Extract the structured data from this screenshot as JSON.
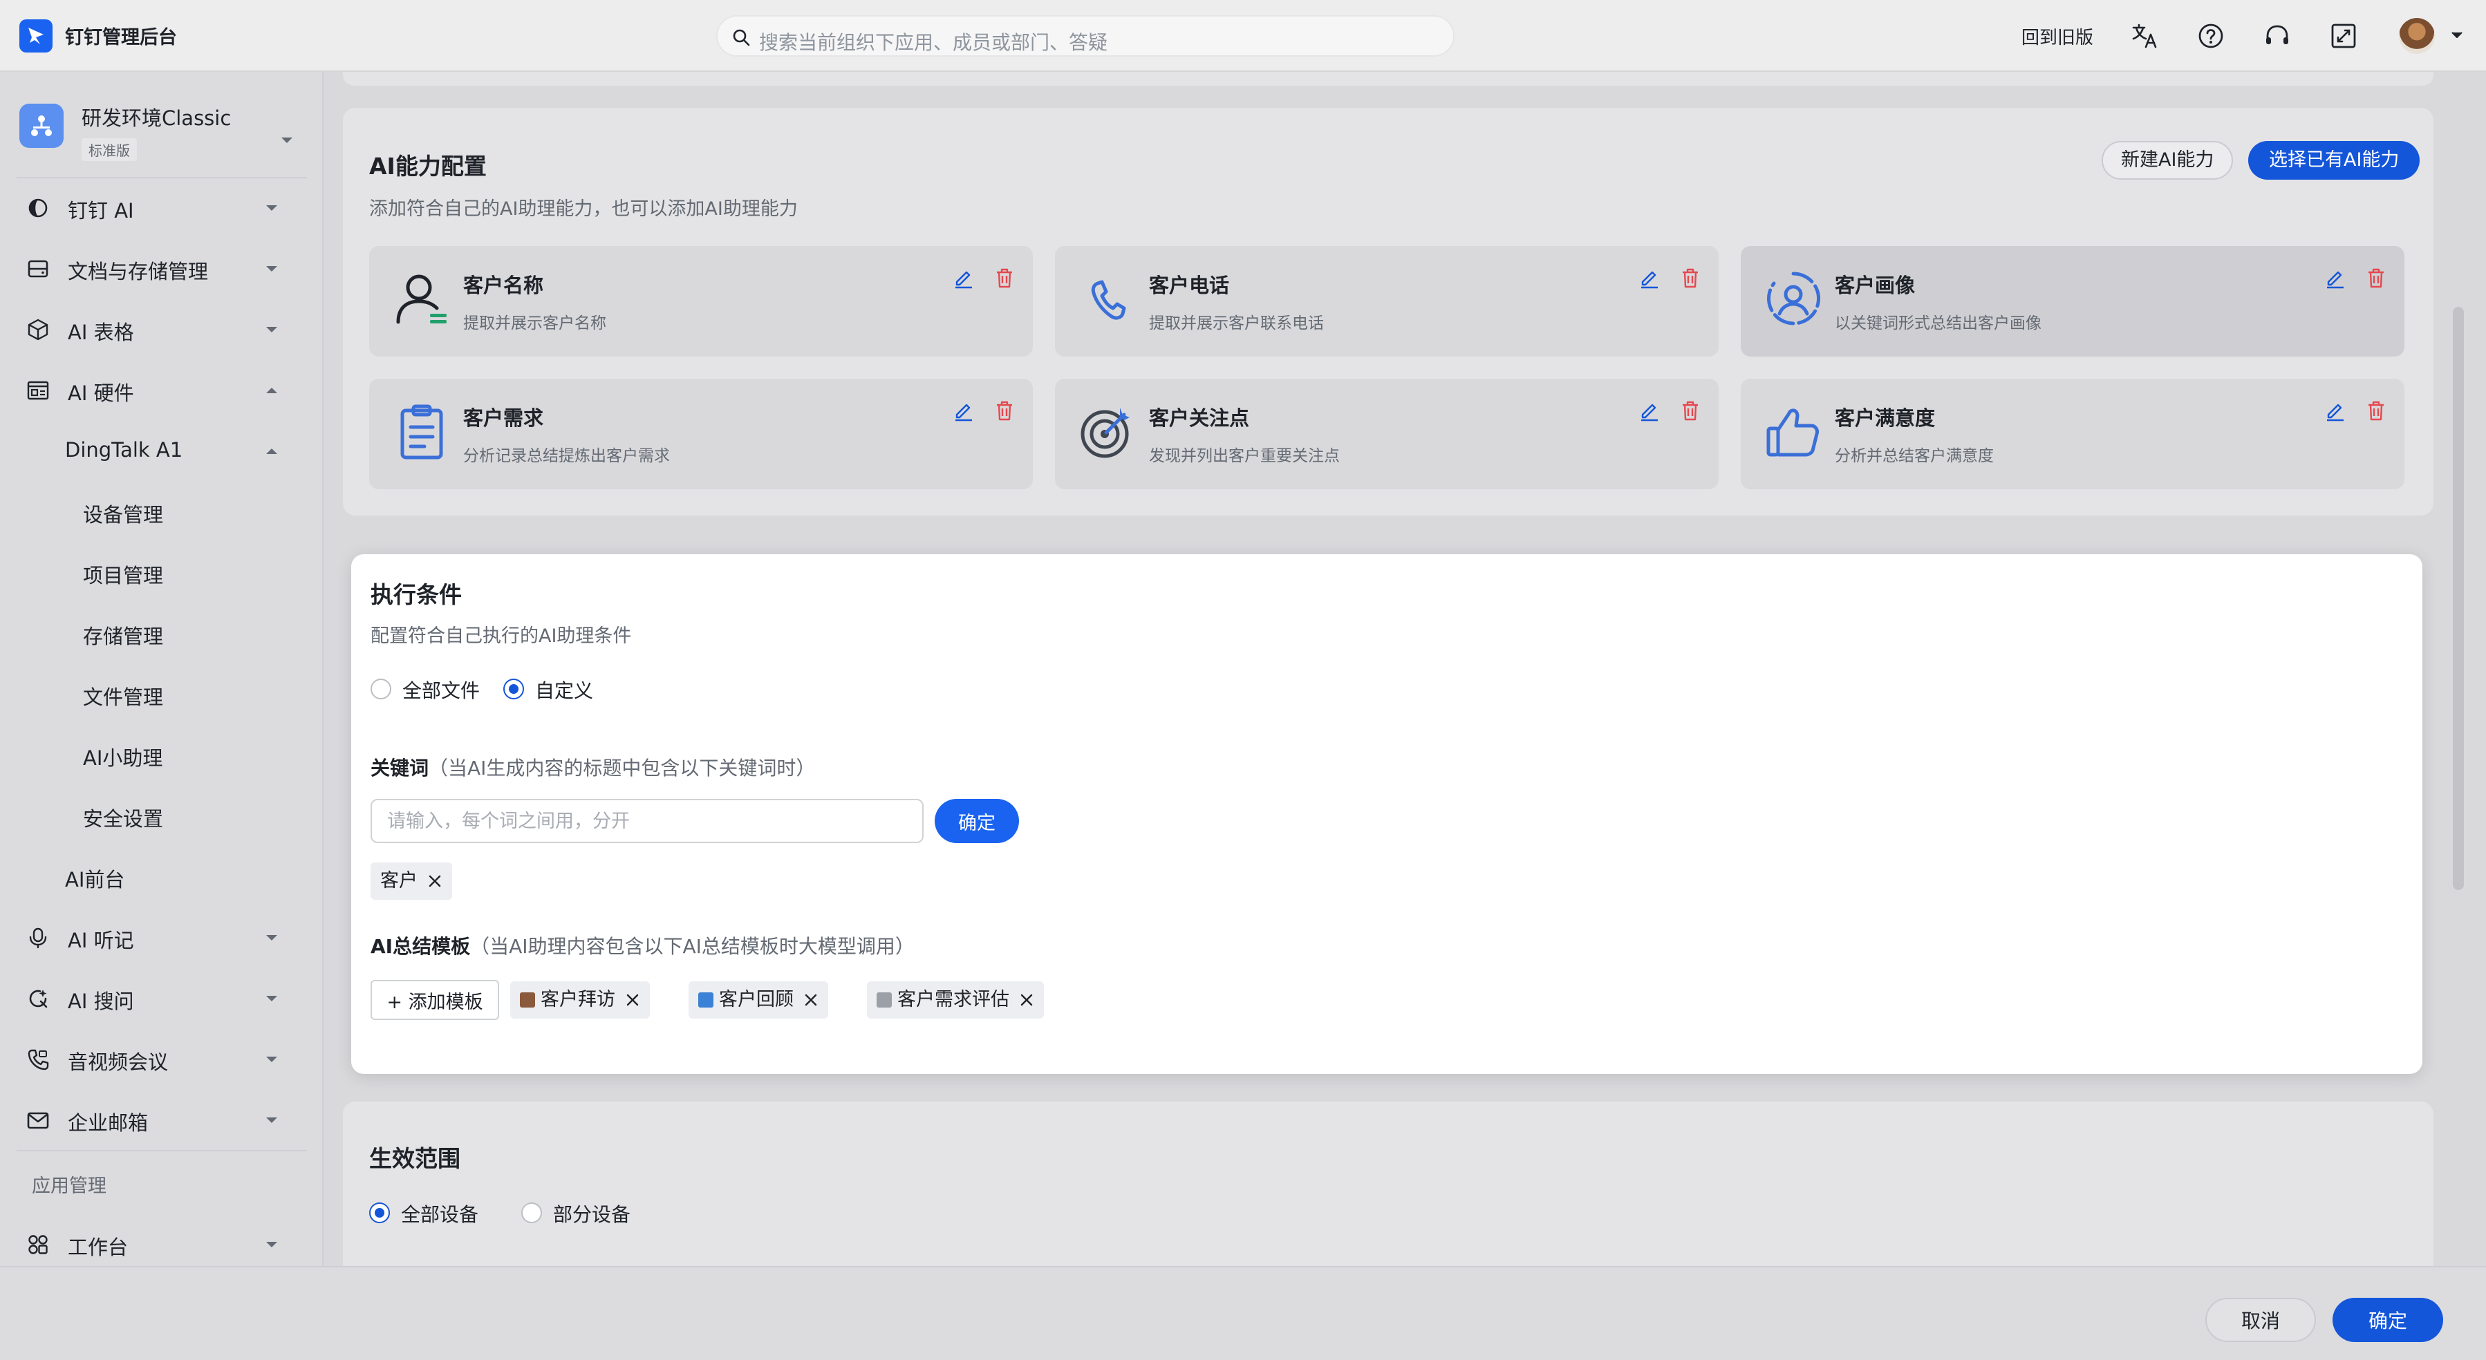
{
  "header": {
    "app_title": "钉钉管理后台",
    "search_placeholder": "搜索当前组织下应用、成员或部门、答疑",
    "back_to_old": "回到旧版",
    "icons": [
      "translate-icon",
      "help-icon",
      "headset-icon",
      "fullscreen-icon"
    ]
  },
  "org": {
    "name": "研发环境Classic",
    "edition": "标准版"
  },
  "sidebar": {
    "items": [
      {
        "label": "钉钉 AI",
        "icon": "dingtalk-ai-icon",
        "expanded": false
      },
      {
        "label": "文档与存储管理",
        "icon": "storage-icon",
        "expanded": false
      },
      {
        "label": "AI 表格",
        "icon": "cube-icon",
        "expanded": false
      },
      {
        "label": "AI 硬件",
        "icon": "hardware-icon",
        "expanded": true
      },
      {
        "label": "DingTalk A1",
        "expanded": true
      },
      {
        "label": "设备管理"
      },
      {
        "label": "项目管理"
      },
      {
        "label": "存储管理"
      },
      {
        "label": "文件管理"
      },
      {
        "label": "AI小助理"
      },
      {
        "label": "安全设置"
      },
      {
        "label": "AI前台"
      },
      {
        "label": "AI 听记",
        "icon": "mic-icon",
        "expanded": false
      },
      {
        "label": "AI 搜问",
        "icon": "search-ask-icon",
        "expanded": false
      },
      {
        "label": "音视频会议",
        "icon": "phone-video-icon",
        "expanded": false
      },
      {
        "label": "企业邮箱",
        "icon": "mail-icon",
        "expanded": false
      },
      {
        "label": "工作台",
        "icon": "grid-icon",
        "expanded": false
      }
    ],
    "section_label": "应用管理"
  },
  "ai_config": {
    "title": "AI能力配置",
    "subtitle": "添加符合自己的AI助理能力，也可以添加AI助理能力",
    "new_button": "新建AI能力",
    "select_button": "选择已有AI能力",
    "capabilities": [
      {
        "name": "客户名称",
        "desc": "提取并展示客户名称",
        "icon": "user-icon"
      },
      {
        "name": "客户电话",
        "desc": "提取并展示客户联系电话",
        "icon": "phone-icon"
      },
      {
        "name": "客户画像",
        "desc": "以关键词形式总结出客户画像",
        "icon": "profile-icon"
      },
      {
        "name": "客户需求",
        "desc": "分析记录总结提炼出客户需求",
        "icon": "clipboard-icon"
      },
      {
        "name": "客户关注点",
        "desc": "发现并列出客户重要关注点",
        "icon": "target-icon"
      },
      {
        "name": "客户满意度",
        "desc": "分析并总结客户满意度",
        "icon": "thumbs-up-icon"
      }
    ]
  },
  "exec": {
    "title": "执行条件",
    "subtitle": "配置符合自己执行的AI助理条件",
    "radio_all": "全部文件",
    "radio_custom": "自定义",
    "keyword_title": "关键词",
    "keyword_hint": "（当AI生成内容的标题中包含以下关键词时）",
    "keyword_placeholder": "请输入，每个词之间用，分开",
    "confirm": "确定",
    "keyword_tags": [
      "客户"
    ],
    "template_title": "AI总结模板",
    "template_hint": "（当AI助理内容包含以下AI总结模板时大模型调用）",
    "add_template": "+ 添加模板",
    "templates": [
      {
        "label": "客户拜访",
        "color": "#8b5a3c"
      },
      {
        "label": "客户回顾",
        "color": "#3b82d6"
      },
      {
        "label": "客户需求评估",
        "color": "#9aa0a6"
      }
    ]
  },
  "scope": {
    "title": "生效范围",
    "radio_all": "全部设备",
    "radio_part": "部分设备"
  },
  "footer": {
    "cancel": "取消",
    "ok": "确定"
  },
  "colors": {
    "primary": "#1456d9",
    "icon_blue": "#3b6fd8",
    "delete_red": "#e5484d"
  }
}
